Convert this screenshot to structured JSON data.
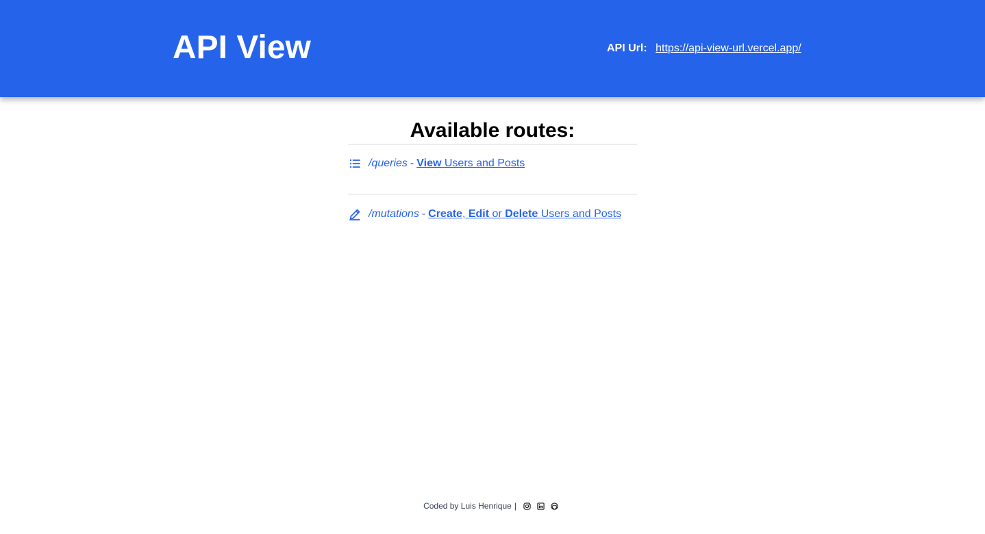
{
  "header": {
    "title": "API View",
    "api_url_label": "API Url:",
    "api_url": "https://api-view-url.vercel.app/"
  },
  "routes": {
    "title": "Available routes:",
    "items": [
      {
        "icon": "list-icon",
        "path": "/queries",
        "separator": "-",
        "action_bold": "View",
        "action_rest": "Users and Posts"
      },
      {
        "icon": "pencil-icon",
        "path": "/mutations",
        "separator": "-",
        "create": "Create",
        "comma": ",",
        "edit": "Edit",
        "or": "or",
        "delete": "Delete",
        "action_rest": "Users and Posts"
      }
    ]
  },
  "footer": {
    "credit": "Coded by Luis Henrique",
    "divider": "|",
    "icons": [
      "instagram-icon",
      "linkedin-icon",
      "github-icon"
    ]
  },
  "colors": {
    "accent": "#2563eb",
    "header_text": "#ffffff",
    "divider": "#d1d5db"
  }
}
